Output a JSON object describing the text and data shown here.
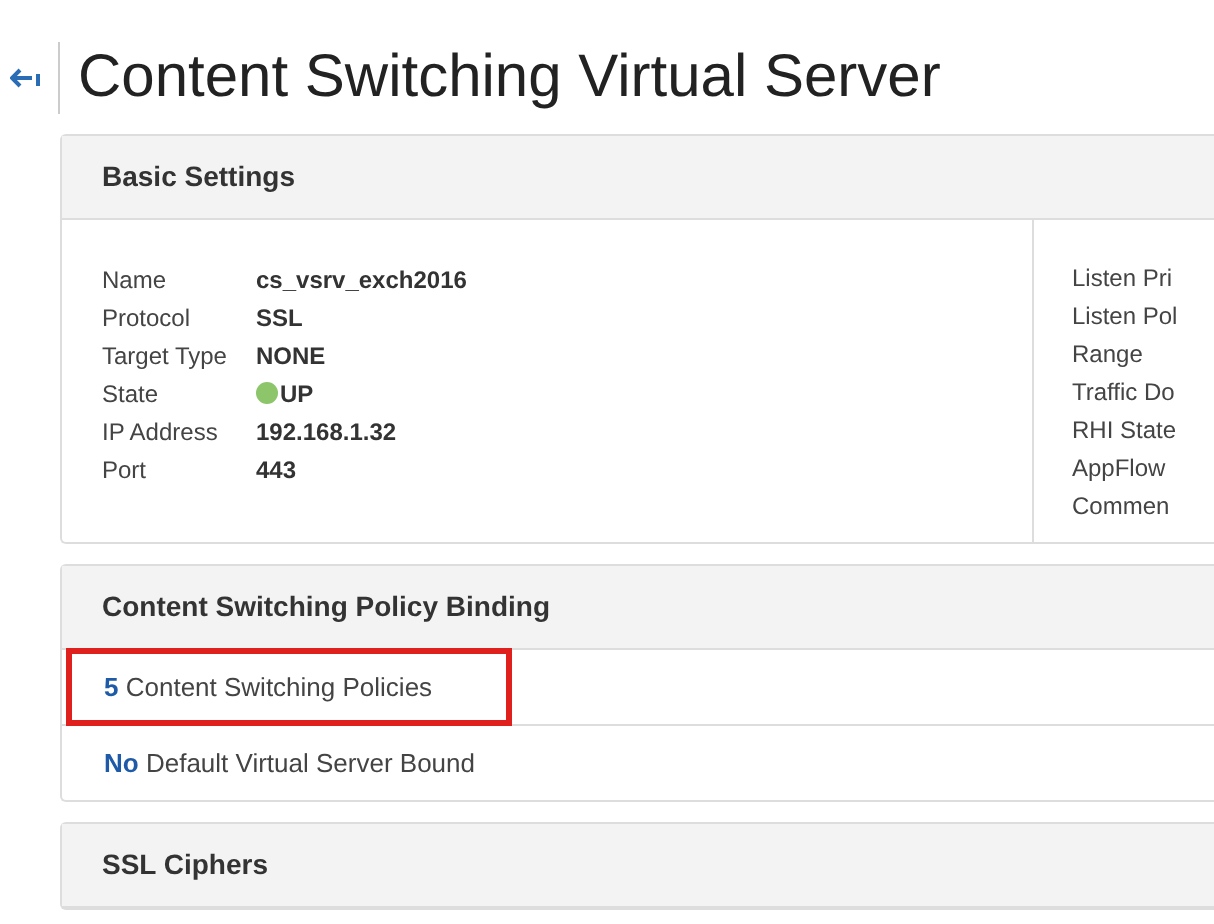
{
  "page": {
    "title": "Content Switching Virtual Server"
  },
  "basic_settings": {
    "heading": "Basic Settings",
    "fields": [
      {
        "label": "Name",
        "value": "cs_vsrv_exch2016"
      },
      {
        "label": "Protocol",
        "value": "SSL"
      },
      {
        "label": "Target Type",
        "value": "NONE"
      },
      {
        "label": "State",
        "value": "UP",
        "color": "#8cc56a"
      },
      {
        "label": "IP Address",
        "value": "192.168.1.32"
      },
      {
        "label": "Port",
        "value": "443"
      }
    ],
    "right_labels": [
      "Listen Pri",
      "Listen Pol",
      "Range",
      "Traffic Do",
      "RHI State",
      "AppFlow",
      "Commen"
    ]
  },
  "policy_binding": {
    "heading": "Content Switching Policy Binding",
    "rows": [
      {
        "count": "5",
        "text": "Content Switching Policies",
        "highlighted": true
      },
      {
        "count": "No",
        "text": "Default Virtual Server Bound",
        "highlighted": false
      }
    ]
  },
  "ssl_ciphers": {
    "heading": "SSL Ciphers"
  }
}
